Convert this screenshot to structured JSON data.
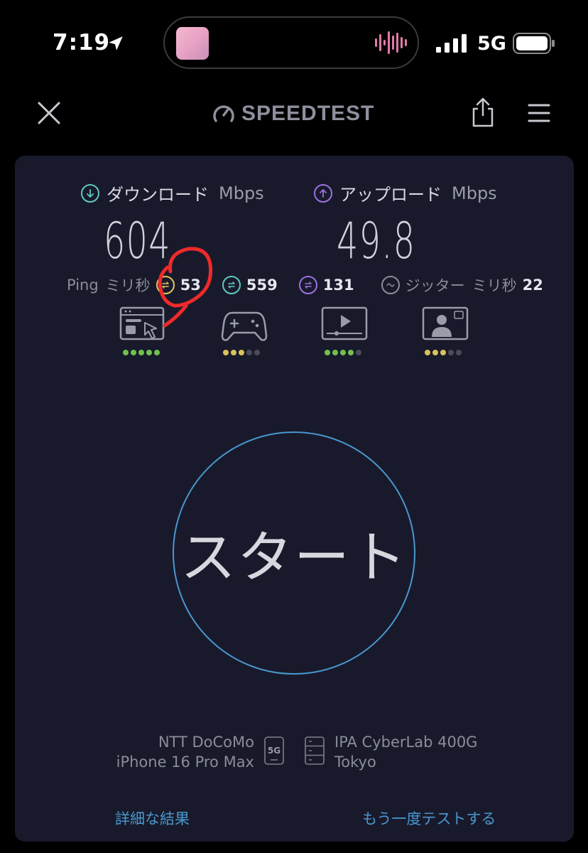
{
  "status_bar": {
    "time": "7:19",
    "network": "5G",
    "icons": [
      "location-arrow-icon",
      "now-playing-thumbnail",
      "waveform-icon",
      "signal-bars-icon",
      "battery-icon"
    ]
  },
  "nav": {
    "logo_text": "SPEEDTEST",
    "icons": [
      "close-icon",
      "speedometer-icon",
      "share-icon",
      "menu-icon"
    ]
  },
  "download": {
    "label": "ダウンロード",
    "unit": "Mbps",
    "value": "604",
    "color": "#62c8bd"
  },
  "upload": {
    "label": "アップロード",
    "unit": "Mbps",
    "value": "49.8",
    "color": "#9e6fe0"
  },
  "ping": {
    "label": "Ping",
    "unit": "ミリ秒",
    "idle": "53",
    "download": "559",
    "upload": "131",
    "jitter_label": "ジッター",
    "jitter_unit": "ミリ秒",
    "jitter": "22",
    "colors": {
      "idle": "#e3c55a",
      "download": "#62c8bd",
      "upload": "#9e6fe0"
    }
  },
  "experience": [
    {
      "icon": "web-browsing-icon",
      "rating": 5,
      "color": "#72c04e"
    },
    {
      "icon": "gaming-icon",
      "rating": 3,
      "color": "#d8c25c"
    },
    {
      "icon": "video-streaming-icon",
      "rating": 4,
      "color": "#72c04e"
    },
    {
      "icon": "video-chat-icon",
      "rating": 3,
      "color": "#d8c25c"
    }
  ],
  "start_button": {
    "label": "スタート"
  },
  "provider": {
    "carrier": "NTT DoCoMo",
    "device": "iPhone 16 Pro Max",
    "badge": "5G"
  },
  "server": {
    "name": "IPA CyberLab 400G",
    "location": "Tokyo"
  },
  "links": {
    "details": "詳細な結果",
    "retest": "もう一度テストする"
  },
  "colors": {
    "background": "#000000",
    "card": "#181a2b",
    "accent": "#4a97cf",
    "annotation": "#ee2a2a"
  }
}
